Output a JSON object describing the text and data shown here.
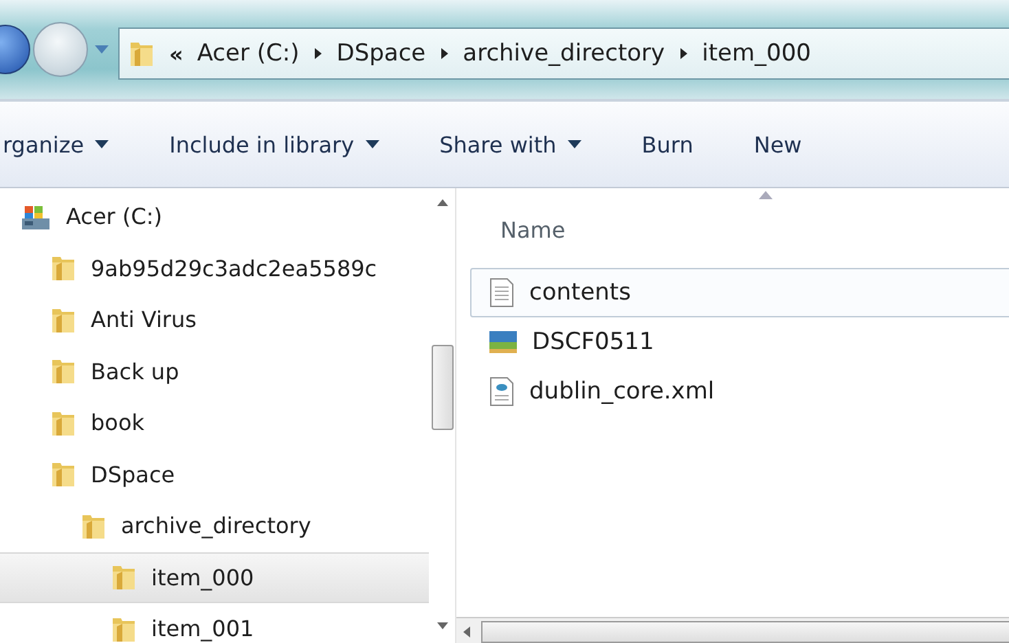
{
  "address_bar": {
    "breadcrumbs": [
      "«",
      "Acer (C:)",
      "DSpace",
      "archive_directory",
      "item_000"
    ]
  },
  "toolbar": [
    {
      "label": "rganize",
      "dropdown": true
    },
    {
      "label": "Include in library",
      "dropdown": true
    },
    {
      "label": "Share with",
      "dropdown": true
    },
    {
      "label": "Burn",
      "dropdown": false
    },
    {
      "label": "New",
      "dropdown": false
    }
  ],
  "navigation_tree": {
    "items": [
      {
        "label": "Acer (C:)",
        "kind": "drive",
        "selected": false,
        "children": [
          {
            "label": "9ab95d29c3adc2ea5589c",
            "kind": "folder",
            "selected": false
          },
          {
            "label": "Anti Virus",
            "kind": "folder",
            "selected": false
          },
          {
            "label": "Back up",
            "kind": "folder",
            "selected": false
          },
          {
            "label": "book",
            "kind": "folder",
            "selected": false
          },
          {
            "label": "DSpace",
            "kind": "folder",
            "selected": false,
            "children": [
              {
                "label": "archive_directory",
                "kind": "folder",
                "selected": false,
                "children": [
                  {
                    "label": "item_000",
                    "kind": "folder",
                    "selected": true
                  },
                  {
                    "label": "item_001",
                    "kind": "folder",
                    "selected": false
                  }
                ]
              }
            ]
          }
        ]
      }
    ]
  },
  "file_list": {
    "columns": [
      "Name"
    ],
    "rows": [
      {
        "name": "contents",
        "kind": "text",
        "selected": true
      },
      {
        "name": "DSCF0511",
        "kind": "image",
        "selected": false
      },
      {
        "name": "dublin_core.xml",
        "kind": "xml",
        "selected": false
      }
    ]
  }
}
